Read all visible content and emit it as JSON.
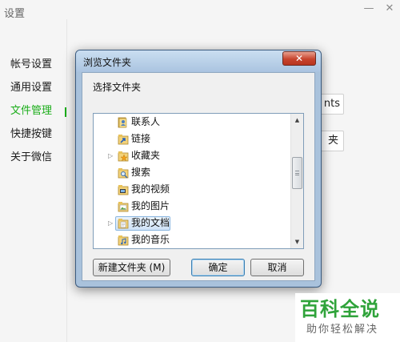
{
  "app": {
    "title": "设置",
    "minimize": "—",
    "close": "✕"
  },
  "settings_nav": {
    "items": [
      {
        "label": "帐号设置"
      },
      {
        "label": "通用设置"
      },
      {
        "label": "文件管理"
      },
      {
        "label": "快捷按键"
      },
      {
        "label": "关于微信"
      }
    ],
    "active_index": 2,
    "accent_color": "#1aad19"
  },
  "background_buttons": {
    "open_folder_partial": "nts",
    "change_partial": "夹"
  },
  "dialog": {
    "title": "浏览文件夹",
    "close_glyph": "✕",
    "prompt": "选择文件夹",
    "tree": {
      "items": [
        {
          "label": "联系人",
          "icon": "contacts-folder-icon",
          "expander": ""
        },
        {
          "label": "链接",
          "icon": "links-folder-icon",
          "expander": ""
        },
        {
          "label": "收藏夹",
          "icon": "favorites-folder-icon",
          "expander": "▷"
        },
        {
          "label": "搜索",
          "icon": "search-folder-icon",
          "expander": ""
        },
        {
          "label": "我的视频",
          "icon": "videos-folder-icon",
          "expander": ""
        },
        {
          "label": "我的图片",
          "icon": "pictures-folder-icon",
          "expander": ""
        },
        {
          "label": "我的文档",
          "icon": "documents-folder-icon",
          "expander": "▷",
          "selected": true
        },
        {
          "label": "我的音乐",
          "icon": "music-folder-icon",
          "expander": ""
        }
      ],
      "scroll_up_glyph": "▲",
      "scroll_down_glyph": "▼"
    },
    "buttons": {
      "new_folder": "新建文件夹 (M)",
      "ok": "确定",
      "cancel": "取消"
    }
  },
  "watermark": {
    "main": "百科全说",
    "sub": "助你轻松解决",
    "color": "#2fa33a"
  }
}
